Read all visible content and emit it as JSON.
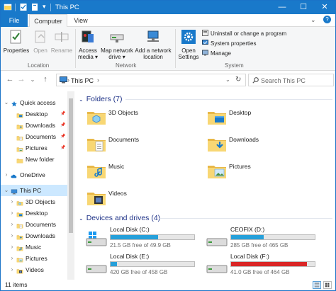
{
  "window": {
    "title": "This PC",
    "caption_buttons": [
      "minimize",
      "maximize",
      "close"
    ]
  },
  "tabs": {
    "file": "File",
    "items": [
      {
        "label": "Computer",
        "active": true
      },
      {
        "label": "View",
        "active": false
      }
    ]
  },
  "ribbon": {
    "location_group": {
      "label": "Location",
      "buttons": [
        {
          "label": "Properties",
          "icon": "properties-icon",
          "enabled": true
        },
        {
          "label": "Open",
          "icon": "open-icon",
          "enabled": false
        },
        {
          "label": "Rename",
          "icon": "rename-icon",
          "enabled": false
        }
      ]
    },
    "network_group": {
      "label": "Network",
      "buttons": [
        {
          "label": "Access\nmedia ▾",
          "icon": "access-media-icon"
        },
        {
          "label": "Map network\ndrive ▾",
          "icon": "map-network-drive-icon"
        },
        {
          "label": "Add a network\nlocation",
          "icon": "add-network-location-icon"
        }
      ]
    },
    "system_group": {
      "label": "System",
      "open_settings": "Open\nSettings",
      "commands": [
        {
          "label": "Uninstall or change a program",
          "icon": "uninstall-icon"
        },
        {
          "label": "System properties",
          "icon": "system-properties-icon"
        },
        {
          "label": "Manage",
          "icon": "manage-icon"
        }
      ]
    }
  },
  "address": {
    "crumb_sep": "›",
    "path": "This PC",
    "trailing": "›",
    "search_placeholder": "Search This PC"
  },
  "nav_pane": {
    "items": [
      {
        "label": "Quick access",
        "icon": "star-icon",
        "level": 0,
        "expander": "⌄",
        "pinned": false
      },
      {
        "label": "Desktop",
        "icon": "desktop-folder-icon",
        "level": 1,
        "expander": "",
        "pinned": true
      },
      {
        "label": "Downloads",
        "icon": "downloads-folder-icon",
        "level": 1,
        "expander": "",
        "pinned": true
      },
      {
        "label": "Documents",
        "icon": "documents-folder-icon",
        "level": 1,
        "expander": "",
        "pinned": true
      },
      {
        "label": "Pictures",
        "icon": "pictures-folder-icon",
        "level": 1,
        "expander": "",
        "pinned": true
      },
      {
        "label": "New folder",
        "icon": "folder-icon",
        "level": 1,
        "expander": "",
        "pinned": false
      },
      {
        "label": "OneDrive",
        "icon": "onedrive-icon",
        "level": 0,
        "expander": "›",
        "pinned": false
      },
      {
        "label": "This PC",
        "icon": "this-pc-icon",
        "level": 0,
        "expander": "⌄",
        "pinned": false,
        "selected": true
      },
      {
        "label": "3D Objects",
        "icon": "3d-objects-folder-icon",
        "level": 1,
        "expander": "›",
        "pinned": false
      },
      {
        "label": "Desktop",
        "icon": "desktop-folder-icon",
        "level": 1,
        "expander": "›",
        "pinned": false
      },
      {
        "label": "Documents",
        "icon": "documents-folder-icon",
        "level": 1,
        "expander": "›",
        "pinned": false
      },
      {
        "label": "Downloads",
        "icon": "downloads-folder-icon",
        "level": 1,
        "expander": "›",
        "pinned": false
      },
      {
        "label": "Music",
        "icon": "music-folder-icon",
        "level": 1,
        "expander": "›",
        "pinned": false
      },
      {
        "label": "Pictures",
        "icon": "pictures-folder-icon",
        "level": 1,
        "expander": "›",
        "pinned": false
      },
      {
        "label": "Videos",
        "icon": "videos-folder-icon",
        "level": 1,
        "expander": "›",
        "pinned": false
      }
    ]
  },
  "folders": {
    "header": "Folders (7)",
    "items": [
      {
        "label": "3D Objects",
        "icon": "3d-objects-folder-icon"
      },
      {
        "label": "Desktop",
        "icon": "desktop-folder-icon"
      },
      {
        "label": "Documents",
        "icon": "documents-folder-icon"
      },
      {
        "label": "Downloads",
        "icon": "downloads-folder-icon"
      },
      {
        "label": "Music",
        "icon": "music-folder-icon"
      },
      {
        "label": "Pictures",
        "icon": "pictures-folder-icon"
      },
      {
        "label": "Videos",
        "icon": "videos-folder-icon"
      }
    ]
  },
  "drives": {
    "header": "Devices and drives (4)",
    "items": [
      {
        "name": "Local Disk (C:)",
        "free": "21.5 GB free of 49.9 GB",
        "used_fraction": 0.57,
        "bar_color": "#26a0da",
        "icon": "windows-drive-icon"
      },
      {
        "name": "CEOFIX (D:)",
        "free": "285 GB free of 465 GB",
        "used_fraction": 0.39,
        "bar_color": "#26a0da",
        "icon": "hard-drive-icon"
      },
      {
        "name": "Local Disk (E:)",
        "free": "420 GB free of 458 GB",
        "used_fraction": 0.08,
        "bar_color": "#26a0da",
        "icon": "hard-drive-icon"
      },
      {
        "name": "Local Disk (F:)",
        "free": "41.0 GB free of 464 GB",
        "used_fraction": 0.91,
        "bar_color": "#da2626",
        "icon": "hard-drive-icon"
      }
    ]
  },
  "status_bar": {
    "item_count": "11 items"
  },
  "colors": {
    "accent": "#1979ca",
    "selection": "#cce8ff",
    "section_header": "#1e3287"
  }
}
